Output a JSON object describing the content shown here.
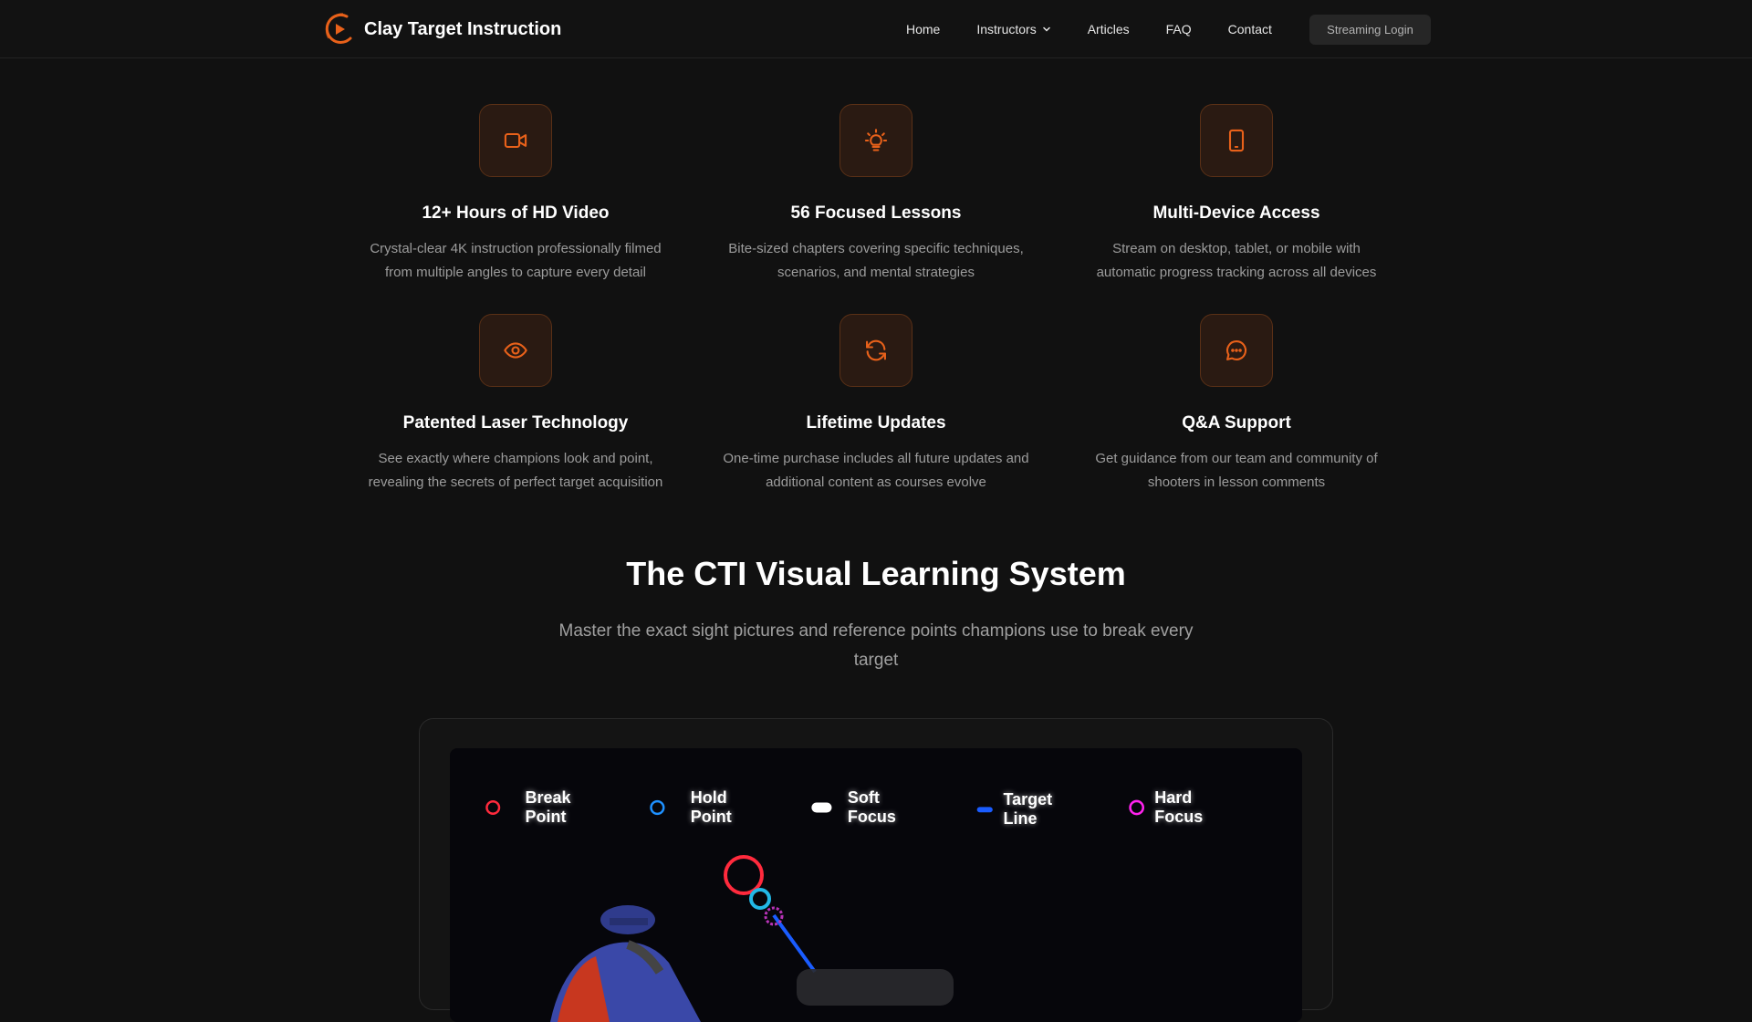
{
  "brand": {
    "name": "Clay Target Instruction",
    "accent": "#e8611a"
  },
  "nav": {
    "links": [
      {
        "label": "Home"
      },
      {
        "label": "Instructors",
        "has_dropdown": true
      },
      {
        "label": "Articles"
      },
      {
        "label": "FAQ"
      },
      {
        "label": "Contact"
      }
    ],
    "login_label": "Streaming Login"
  },
  "features": [
    {
      "icon": "video-camera-icon",
      "title": "12+ Hours of HD Video",
      "desc_line1": "Crystal-clear 4K instruction professionally filmed",
      "desc_line2": "from multiple angles to capture every detail"
    },
    {
      "icon": "lightbulb-icon",
      "title": "56 Focused Lessons",
      "desc_line1": "Bite-sized chapters covering specific techniques,",
      "desc_line2": "scenarios, and mental strategies"
    },
    {
      "icon": "mobile-device-icon",
      "title": "Multi-Device Access",
      "desc_line1": "Stream on desktop, tablet, or mobile with",
      "desc_line2": "automatic progress tracking across all devices"
    },
    {
      "icon": "eye-icon",
      "title": "Patented Laser Technology",
      "desc_line1": "See exactly where champions look and point,",
      "desc_line2": "revealing the secrets of perfect target acquisition"
    },
    {
      "icon": "refresh-icon",
      "title": "Lifetime Updates",
      "desc_line1": "One-time purchase includes all future updates and",
      "desc_line2": "additional content as courses evolve"
    },
    {
      "icon": "chat-bubble-icon",
      "title": "Q&A Support",
      "desc_line1": "Get guidance from our team and community of",
      "desc_line2": "shooters in lesson comments"
    }
  ],
  "section": {
    "title": "The CTI Visual Learning System",
    "subtitle": "Master the exact sight pictures and reference points champions use to break every target"
  },
  "legend": [
    {
      "label": "Break Point",
      "color": "#ff2a3d",
      "shape": "ring"
    },
    {
      "label": "Hold Point",
      "color": "#1e90ff",
      "shape": "ring"
    },
    {
      "label": "Soft Focus",
      "color": "#ffffff",
      "shape": "pill"
    },
    {
      "label": "Target Line",
      "color": "#1a5cff",
      "shape": "bar"
    },
    {
      "label": "Hard Focus",
      "color": "#ff22ee",
      "shape": "ring"
    }
  ]
}
